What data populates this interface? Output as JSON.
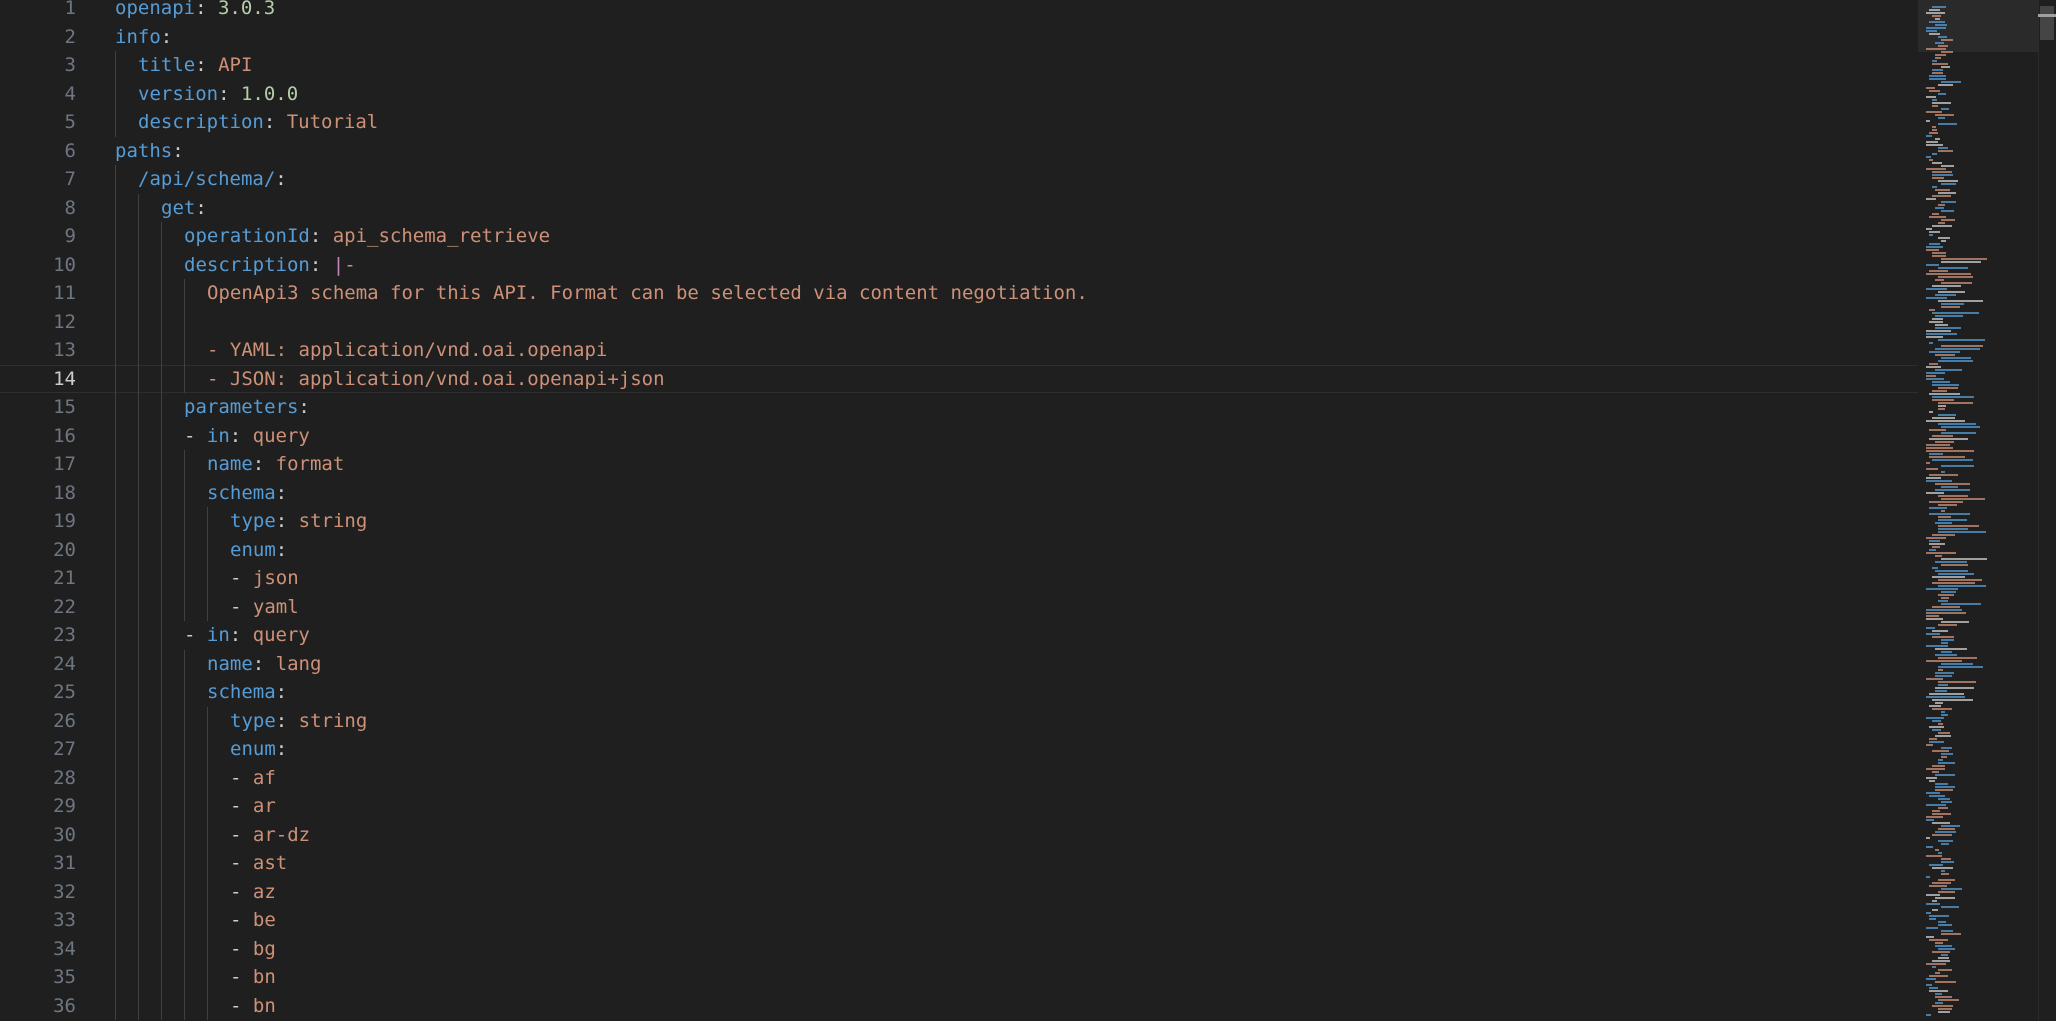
{
  "editor": {
    "current_line": 14,
    "lines": [
      {
        "num": "1",
        "indent": 0,
        "tokens": [
          [
            "k",
            "openapi"
          ],
          [
            "p",
            ": "
          ],
          [
            "n",
            "3.0.3"
          ]
        ]
      },
      {
        "num": "2",
        "indent": 0,
        "tokens": [
          [
            "k",
            "info"
          ],
          [
            "p",
            ":"
          ]
        ]
      },
      {
        "num": "3",
        "indent": 1,
        "tokens": [
          [
            "k",
            "title"
          ],
          [
            "p",
            ": "
          ],
          [
            "s",
            "API"
          ]
        ]
      },
      {
        "num": "4",
        "indent": 1,
        "tokens": [
          [
            "k",
            "version"
          ],
          [
            "p",
            ": "
          ],
          [
            "n",
            "1.0.0"
          ]
        ]
      },
      {
        "num": "5",
        "indent": 1,
        "tokens": [
          [
            "k",
            "description"
          ],
          [
            "p",
            ": "
          ],
          [
            "s",
            "Tutorial"
          ]
        ]
      },
      {
        "num": "6",
        "indent": 0,
        "tokens": [
          [
            "k",
            "paths"
          ],
          [
            "p",
            ":"
          ]
        ]
      },
      {
        "num": "7",
        "indent": 1,
        "tokens": [
          [
            "k",
            "/api/schema/"
          ],
          [
            "p",
            ":"
          ]
        ]
      },
      {
        "num": "8",
        "indent": 2,
        "tokens": [
          [
            "k",
            "get"
          ],
          [
            "p",
            ":"
          ]
        ]
      },
      {
        "num": "9",
        "indent": 3,
        "tokens": [
          [
            "k",
            "operationId"
          ],
          [
            "p",
            ": "
          ],
          [
            "s",
            "api_schema_retrieve"
          ]
        ]
      },
      {
        "num": "10",
        "indent": 3,
        "tokens": [
          [
            "k",
            "description"
          ],
          [
            "p",
            ": "
          ],
          [
            "pipe",
            "|"
          ],
          [
            "s",
            "-"
          ]
        ]
      },
      {
        "num": "11",
        "indent": 4,
        "tokens": [
          [
            "s",
            "OpenApi3 schema for this API. Format can be selected via content negotiation."
          ]
        ]
      },
      {
        "num": "12",
        "indent": 4,
        "tokens": []
      },
      {
        "num": "13",
        "indent": 4,
        "tokens": [
          [
            "s",
            "- YAML: application/vnd.oai.openapi"
          ]
        ]
      },
      {
        "num": "14",
        "indent": 4,
        "tokens": [
          [
            "s",
            "- JSON: application/vnd.oai.openapi+json"
          ]
        ]
      },
      {
        "num": "15",
        "indent": 3,
        "tokens": [
          [
            "k",
            "parameters"
          ],
          [
            "p",
            ":"
          ]
        ]
      },
      {
        "num": "16",
        "indent": 3,
        "tokens": [
          [
            "p",
            "- "
          ],
          [
            "k",
            "in"
          ],
          [
            "p",
            ": "
          ],
          [
            "s",
            "query"
          ]
        ]
      },
      {
        "num": "17",
        "indent": 4,
        "tokens": [
          [
            "k",
            "name"
          ],
          [
            "p",
            ": "
          ],
          [
            "s",
            "format"
          ]
        ]
      },
      {
        "num": "18",
        "indent": 4,
        "tokens": [
          [
            "k",
            "schema"
          ],
          [
            "p",
            ":"
          ]
        ]
      },
      {
        "num": "19",
        "indent": 5,
        "tokens": [
          [
            "k",
            "type"
          ],
          [
            "p",
            ": "
          ],
          [
            "s",
            "string"
          ]
        ]
      },
      {
        "num": "20",
        "indent": 5,
        "tokens": [
          [
            "k",
            "enum"
          ],
          [
            "p",
            ":"
          ]
        ]
      },
      {
        "num": "21",
        "indent": 5,
        "tokens": [
          [
            "p",
            "- "
          ],
          [
            "s",
            "json"
          ]
        ]
      },
      {
        "num": "22",
        "indent": 5,
        "tokens": [
          [
            "p",
            "- "
          ],
          [
            "s",
            "yaml"
          ]
        ]
      },
      {
        "num": "23",
        "indent": 3,
        "tokens": [
          [
            "p",
            "- "
          ],
          [
            "k",
            "in"
          ],
          [
            "p",
            ": "
          ],
          [
            "s",
            "query"
          ]
        ]
      },
      {
        "num": "24",
        "indent": 4,
        "tokens": [
          [
            "k",
            "name"
          ],
          [
            "p",
            ": "
          ],
          [
            "s",
            "lang"
          ]
        ]
      },
      {
        "num": "25",
        "indent": 4,
        "tokens": [
          [
            "k",
            "schema"
          ],
          [
            "p",
            ":"
          ]
        ]
      },
      {
        "num": "26",
        "indent": 5,
        "tokens": [
          [
            "k",
            "type"
          ],
          [
            "p",
            ": "
          ],
          [
            "s",
            "string"
          ]
        ]
      },
      {
        "num": "27",
        "indent": 5,
        "tokens": [
          [
            "k",
            "enum"
          ],
          [
            "p",
            ":"
          ]
        ]
      },
      {
        "num": "28",
        "indent": 5,
        "tokens": [
          [
            "p",
            "- "
          ],
          [
            "s",
            "af"
          ]
        ]
      },
      {
        "num": "29",
        "indent": 5,
        "tokens": [
          [
            "p",
            "- "
          ],
          [
            "s",
            "ar"
          ]
        ]
      },
      {
        "num": "30",
        "indent": 5,
        "tokens": [
          [
            "p",
            "- "
          ],
          [
            "s",
            "ar-dz"
          ]
        ]
      },
      {
        "num": "31",
        "indent": 5,
        "tokens": [
          [
            "p",
            "- "
          ],
          [
            "s",
            "ast"
          ]
        ]
      },
      {
        "num": "32",
        "indent": 5,
        "tokens": [
          [
            "p",
            "- "
          ],
          [
            "s",
            "az"
          ]
        ]
      },
      {
        "num": "33",
        "indent": 5,
        "tokens": [
          [
            "p",
            "- "
          ],
          [
            "s",
            "be"
          ]
        ]
      },
      {
        "num": "34",
        "indent": 5,
        "tokens": [
          [
            "p",
            "- "
          ],
          [
            "s",
            "bg"
          ]
        ]
      },
      {
        "num": "35",
        "indent": 5,
        "tokens": [
          [
            "p",
            "- "
          ],
          [
            "s",
            "bn"
          ]
        ]
      },
      {
        "num": "36",
        "indent": 5,
        "tokens": [
          [
            "p",
            "- "
          ],
          [
            "s",
            "bn"
          ]
        ]
      }
    ]
  },
  "colors": {
    "background": "#1f1f1f",
    "key": "#569cd6",
    "string": "#ce9178",
    "number": "#b5cea8",
    "punctuation": "#cccccc",
    "line_number": "#6e7681"
  }
}
